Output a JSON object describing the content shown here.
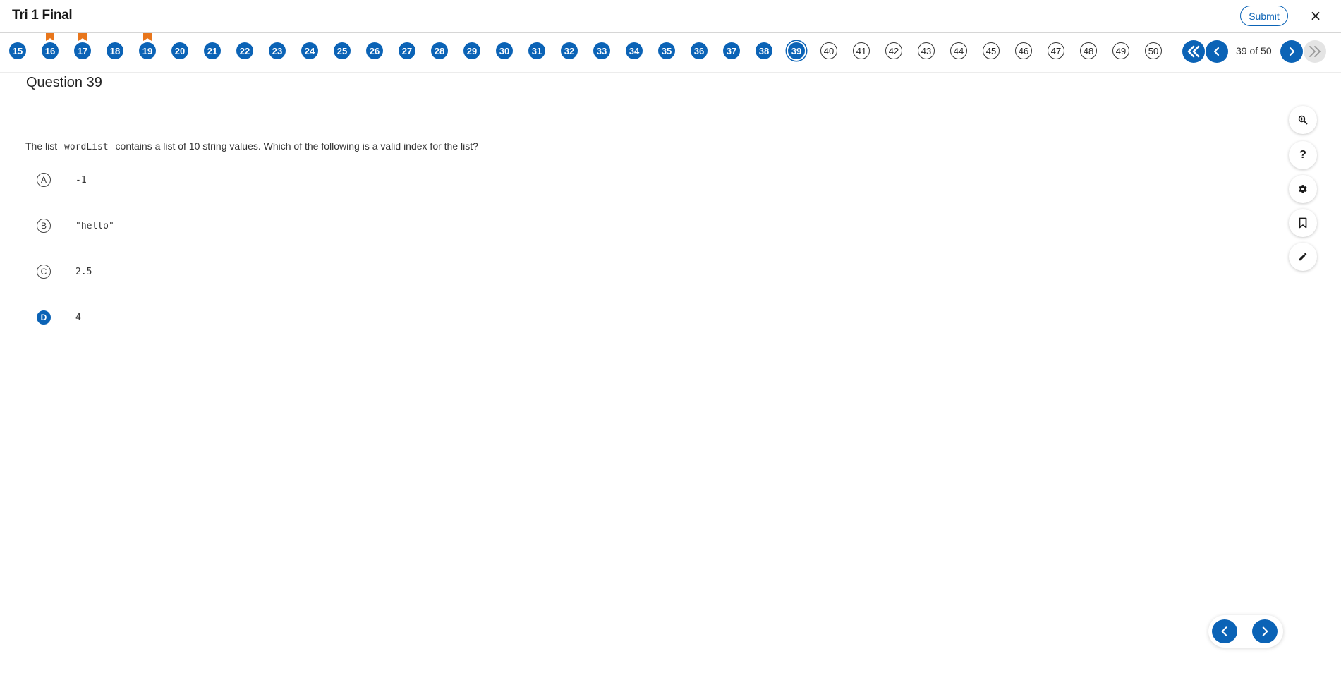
{
  "header": {
    "title": "Tri 1 Final",
    "submit_label": "Submit",
    "close_label": "×"
  },
  "question_nav": {
    "items": [
      {
        "num": "15",
        "state": "answered",
        "flagged": false
      },
      {
        "num": "16",
        "state": "answered",
        "flagged": true
      },
      {
        "num": "17",
        "state": "answered",
        "flagged": true
      },
      {
        "num": "18",
        "state": "answered",
        "flagged": false
      },
      {
        "num": "19",
        "state": "answered",
        "flagged": true
      },
      {
        "num": "20",
        "state": "answered",
        "flagged": false
      },
      {
        "num": "21",
        "state": "answered",
        "flagged": false
      },
      {
        "num": "22",
        "state": "answered",
        "flagged": false
      },
      {
        "num": "23",
        "state": "answered",
        "flagged": false
      },
      {
        "num": "24",
        "state": "answered",
        "flagged": false
      },
      {
        "num": "25",
        "state": "answered",
        "flagged": false
      },
      {
        "num": "26",
        "state": "answered",
        "flagged": false
      },
      {
        "num": "27",
        "state": "answered",
        "flagged": false
      },
      {
        "num": "28",
        "state": "answered",
        "flagged": false
      },
      {
        "num": "29",
        "state": "answered",
        "flagged": false
      },
      {
        "num": "30",
        "state": "answered",
        "flagged": false
      },
      {
        "num": "31",
        "state": "answered",
        "flagged": false
      },
      {
        "num": "32",
        "state": "answered",
        "flagged": false
      },
      {
        "num": "33",
        "state": "answered",
        "flagged": false
      },
      {
        "num": "34",
        "state": "answered",
        "flagged": false
      },
      {
        "num": "35",
        "state": "answered",
        "flagged": false
      },
      {
        "num": "36",
        "state": "answered",
        "flagged": false
      },
      {
        "num": "37",
        "state": "answered",
        "flagged": false
      },
      {
        "num": "38",
        "state": "answered",
        "flagged": false
      },
      {
        "num": "39",
        "state": "current",
        "flagged": false
      },
      {
        "num": "40",
        "state": "unanswered",
        "flagged": false
      },
      {
        "num": "41",
        "state": "unanswered",
        "flagged": false
      },
      {
        "num": "42",
        "state": "unanswered",
        "flagged": false
      },
      {
        "num": "43",
        "state": "unanswered",
        "flagged": false
      },
      {
        "num": "44",
        "state": "unanswered",
        "flagged": false
      },
      {
        "num": "45",
        "state": "unanswered",
        "flagged": false
      },
      {
        "num": "46",
        "state": "unanswered",
        "flagged": false
      },
      {
        "num": "47",
        "state": "unanswered",
        "flagged": false
      },
      {
        "num": "48",
        "state": "unanswered",
        "flagged": false
      },
      {
        "num": "49",
        "state": "unanswered",
        "flagged": false
      },
      {
        "num": "50",
        "state": "unanswered",
        "flagged": false
      }
    ],
    "position_label": "39 of 50",
    "icons": {
      "first": "double-chevron-left-icon",
      "prev": "chevron-left-icon",
      "next": "chevron-right-icon",
      "last": "double-chevron-right-icon"
    }
  },
  "question": {
    "title": "Question 39",
    "text_before": "The list",
    "code": "wordList",
    "text_after": "contains a list of 10 string values. Which of the following is a valid index for the list?",
    "choices": [
      {
        "letter": "A",
        "value": "-1",
        "selected": false
      },
      {
        "letter": "B",
        "value": "\"hello\"",
        "selected": false
      },
      {
        "letter": "C",
        "value": "2.5",
        "selected": false
      },
      {
        "letter": "D",
        "value": "4",
        "selected": true
      }
    ]
  },
  "tools": {
    "zoom_icon": "zoom-in-icon",
    "help_label": "?",
    "settings_icon": "gear-icon",
    "bookmark_icon": "bookmark-icon",
    "annotate_icon": "pencil-icon"
  },
  "colors": {
    "accent": "#0b63b6",
    "flag": "#e8761c",
    "disabled": "#e4e4e4"
  }
}
